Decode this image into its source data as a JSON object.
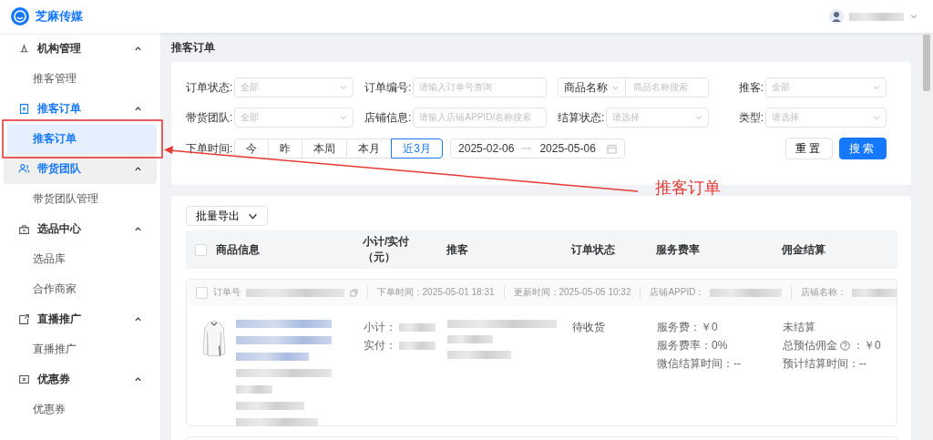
{
  "header": {
    "brand": "芝麻传媒"
  },
  "sidebar": {
    "groups": [
      {
        "label": "机构管理",
        "expanded": true,
        "active": false,
        "hovered": false,
        "items": [
          {
            "label": "推客管理",
            "selected": false
          }
        ]
      },
      {
        "label": "推客订单",
        "expanded": true,
        "active": true,
        "hovered": false,
        "items": [
          {
            "label": "推客订单",
            "selected": true
          }
        ]
      },
      {
        "label": "带货团队",
        "expanded": true,
        "active": true,
        "hovered": true,
        "items": [
          {
            "label": "带货团队管理",
            "selected": false
          }
        ]
      },
      {
        "label": "选品中心",
        "expanded": true,
        "active": false,
        "hovered": false,
        "items": [
          {
            "label": "选品库",
            "selected": false
          },
          {
            "label": "合作商家",
            "selected": false
          }
        ]
      },
      {
        "label": "直播推广",
        "expanded": true,
        "active": false,
        "hovered": false,
        "items": [
          {
            "label": "直播推广",
            "selected": false
          }
        ]
      },
      {
        "label": "优惠券",
        "expanded": true,
        "active": false,
        "hovered": false,
        "items": [
          {
            "label": "优惠券",
            "selected": false
          }
        ]
      }
    ]
  },
  "page_title": "推客订单",
  "filters": {
    "rows": [
      {
        "fields": [
          {
            "kind": "select",
            "label": "订单状态:",
            "placeholder": "全部"
          },
          {
            "kind": "input",
            "label": "订单编号:",
            "placeholder": "请输入订单号查询"
          },
          {
            "kind": "prefixed",
            "prefix": "商品名称",
            "placeholder": "商品名称搜索"
          },
          {
            "kind": "select",
            "label": "推客:",
            "placeholder": "全部"
          }
        ]
      },
      {
        "fields": [
          {
            "kind": "select",
            "label": "带货团队:",
            "placeholder": "全部"
          },
          {
            "kind": "input",
            "label": "店铺信息:",
            "placeholder": "请输入店铺APPID/名称搜索"
          },
          {
            "kind": "select",
            "label": "结算状态:",
            "placeholder": "请选择"
          },
          {
            "kind": "select",
            "label": "类型:",
            "placeholder": "请选择"
          }
        ]
      }
    ],
    "time": {
      "label": "下单时间:",
      "options": [
        {
          "label": "今",
          "selected": false
        },
        {
          "label": "昨",
          "selected": false
        },
        {
          "label": "本周",
          "selected": false
        },
        {
          "label": "本月",
          "selected": false
        },
        {
          "label": "近3月",
          "selected": true
        }
      ],
      "date_start": "2025-02-06",
      "date_end": "2025-05-06"
    },
    "reset_button": "重置",
    "search_button": "搜索"
  },
  "table": {
    "export_button": "批量导出",
    "select_all_checked": false,
    "columns": [
      [
        "商品信息"
      ],
      [
        "小计/实付",
        "（元）"
      ],
      [
        "推客"
      ],
      [
        "订单状态"
      ],
      [
        "服务费率"
      ],
      [
        "佣金结算"
      ]
    ],
    "orders": [
      {
        "checked": false,
        "order_no_label": "订单号",
        "placed_time": "下单时间：2025-05-01 18:31",
        "updated_time": "更新时间：2025-05-05 10:32",
        "shop_appid_label": "店铺APPID：",
        "shop_name_label": "店铺名称：",
        "subtotal_label": "小计：",
        "paid_label": "实付：",
        "status": "待收货",
        "service": [
          "服务费：￥0",
          "服务费率：0%",
          "微信结算时间：--"
        ],
        "commission_status": "未结算",
        "estimate_label": "总预估佣金",
        "estimate_value": "：￥0",
        "settle_time": "预计结算时间：--"
      }
    ]
  },
  "annotation": {
    "label": "推客订单"
  }
}
